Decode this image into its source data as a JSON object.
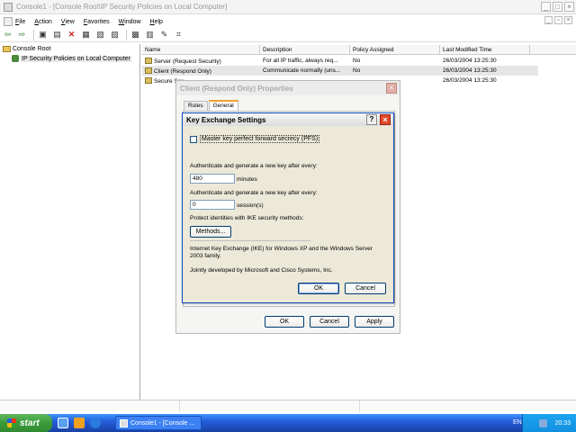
{
  "window": {
    "title": "Console1 - [Console Root\\IP Security Policies on Local Computer]"
  },
  "menu": [
    "File",
    "Action",
    "View",
    "Favorites",
    "Window",
    "Help"
  ],
  "tree": {
    "root": "Console Root",
    "child": "IP Security Policies on Local Computer"
  },
  "list": {
    "columns": [
      "Name",
      "Description",
      "Policy Assigned",
      "Last Modified Time"
    ],
    "rows": [
      {
        "name": "Server (Request Security)",
        "description": "For all IP traffic, always req...",
        "assigned": "No",
        "modified": "26/03/2004 13:25:30"
      },
      {
        "name": "Client (Respond Only)",
        "description": "Communicate normally (uns...",
        "assigned": "No",
        "modified": "26/03/2004 13:25:30"
      },
      {
        "name": "Secure Ser",
        "description": "",
        "assigned": "",
        "modified": "26/03/2004 13:25:30"
      }
    ]
  },
  "props_dialog": {
    "title": "Client (Respond Only) Properties",
    "tabs": [
      "Rules",
      "General"
    ],
    "ok": "OK",
    "cancel": "Cancel",
    "apply": "Apply"
  },
  "kes_dialog": {
    "title": "Key Exchange Settings",
    "checkbox_label": "Master key perfect forward secrecy (PFS)",
    "label_minutes": "Authenticate and generate a new key after every:",
    "minutes_value": "480",
    "minutes_unit": "minutes",
    "label_sessions": "Authenticate and generate a new key after every:",
    "sessions_value": "0",
    "sessions_unit": "session(s)",
    "label_methods": "Protect identities with IKE security methods:",
    "methods_button": "Methods...",
    "info1": "Internet Key Exchange (IKE) for Windows XP and the Windows Server 2003 family.",
    "info2": "Jointly developed by Microsoft and Cisco Systems, Inc.",
    "ok": "OK",
    "cancel": "Cancel"
  },
  "taskbar": {
    "start": "start",
    "task": "Console1 - [Console ...",
    "lang": "EN",
    "clock": "20:33"
  }
}
